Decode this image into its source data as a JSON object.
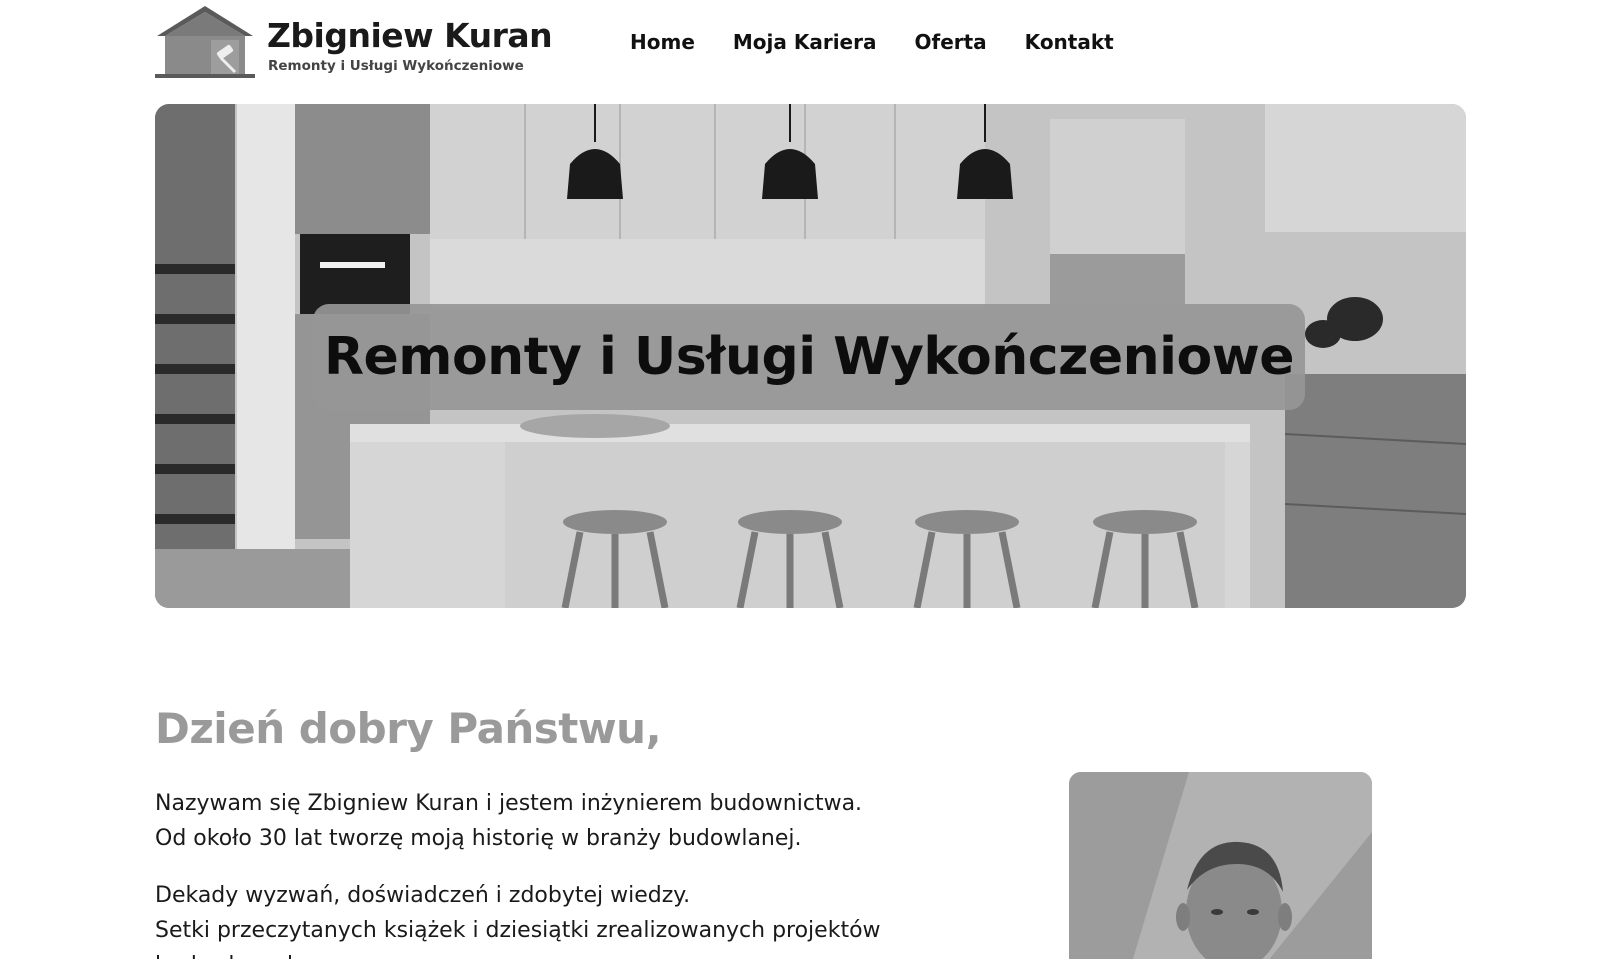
{
  "header": {
    "logo": {
      "title": "Zbigniew Kuran",
      "subtitle": "Remonty i Usługi Wykończeniowe",
      "icon": "house-paint-roller-icon"
    },
    "nav": [
      {
        "label": "Home"
      },
      {
        "label": "Moja Kariera"
      },
      {
        "label": "Oferta"
      },
      {
        "label": "Kontakt"
      }
    ]
  },
  "hero": {
    "heading": "Remonty i Usługi Wykończeniowe",
    "image": "kitchen-interior-photo"
  },
  "intro": {
    "greeting": "Dzień dobry Państwu,",
    "paragraph1": [
      "Nazywam się Zbigniew Kuran i jestem inżynierem budownictwa.",
      "Od około 30 lat tworzę moją historię w branży budowlanej."
    ],
    "paragraph2": [
      "Dekady wyzwań, doświadczeń i zdobytej wiedzy.",
      "Setki przeczytanych książek i dziesiątki zrealizowanych projektów",
      "budowlanych."
    ],
    "portrait": "owner-portrait-photo"
  },
  "colors": {
    "background": "#ffffff",
    "greeting": "#9a9a9a",
    "banner": "#969696"
  }
}
